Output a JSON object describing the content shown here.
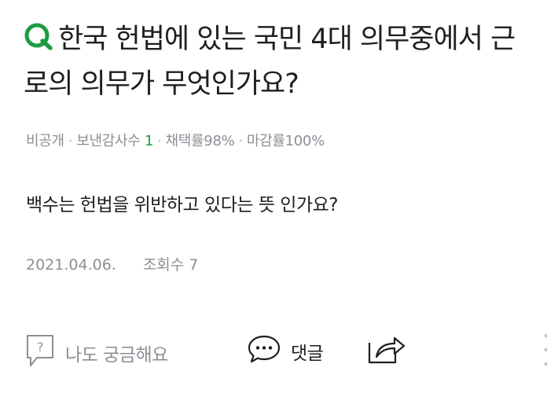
{
  "question": {
    "badge": "Q",
    "title": "한국 헌법에 있는 국민 4대 의무중에서 근로의 의무가 무엇인가요?"
  },
  "meta": {
    "privacy": "비공개",
    "thanks_label": "보낸감사수",
    "thanks_count": "1",
    "adoption_rate": "채택률98%",
    "close_rate": "마감률100%"
  },
  "body": {
    "text": "백수는 헌법을 위반하고 있다는 뜻 인가요?"
  },
  "footer": {
    "date": "2021.04.06.",
    "views": "조회수 7"
  },
  "actions": {
    "curious_label": "나도 궁금해요",
    "comment_label": "댓글"
  },
  "colors": {
    "accent_green": "#1f9a43",
    "text": "#1e1e23",
    "muted": "#8b8f95"
  }
}
